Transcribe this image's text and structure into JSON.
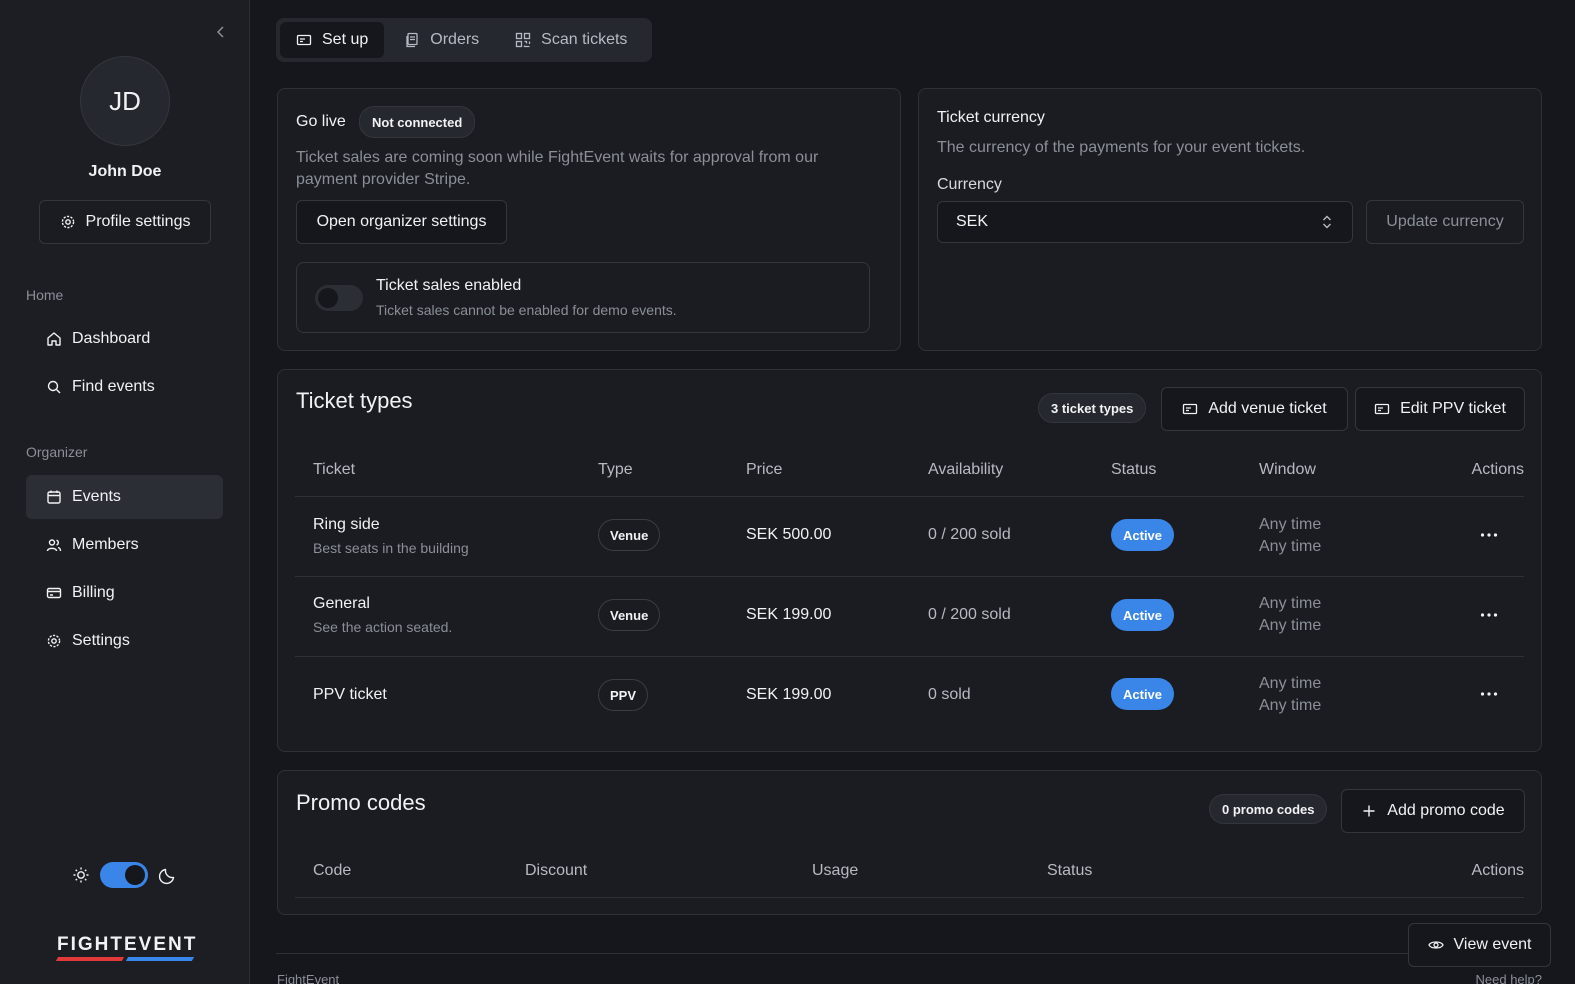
{
  "user": {
    "initials": "JD",
    "name": "John Doe",
    "profile_settings": "Profile settings"
  },
  "sidebar": {
    "home_label": "Home",
    "organizer_label": "Organizer",
    "items": [
      {
        "label": "Dashboard",
        "icon": "home-icon"
      },
      {
        "label": "Find events",
        "icon": "search-icon"
      },
      {
        "label": "Events",
        "icon": "calendar-icon",
        "active": true
      },
      {
        "label": "Members",
        "icon": "users-icon"
      },
      {
        "label": "Billing",
        "icon": "credit-card-icon"
      },
      {
        "label": "Settings",
        "icon": "gear-icon"
      }
    ],
    "theme": "dark"
  },
  "logo": {
    "text": "FIGHTEVENT",
    "colors": [
      "#e23a3a",
      "#3a86e8"
    ]
  },
  "tabs": [
    {
      "label": "Set up",
      "icon": "ticket-icon",
      "active": true
    },
    {
      "label": "Orders",
      "icon": "receipt-icon"
    },
    {
      "label": "Scan tickets",
      "icon": "qr-icon"
    }
  ],
  "go_live": {
    "title": "Go live",
    "status": "Not connected",
    "description": "Ticket sales are coming soon while FightEvent waits for approval from our payment provider Stripe.",
    "open_settings": "Open organizer settings",
    "toggle_label": "Ticket sales enabled",
    "toggle_desc": "Ticket sales cannot be enabled for demo events.",
    "enabled": false
  },
  "currency": {
    "title": "Ticket currency",
    "description": "The currency of the payments for your event tickets.",
    "field_label": "Currency",
    "value": "SEK",
    "update": "Update currency"
  },
  "ticket_types": {
    "title": "Ticket types",
    "count": "3 ticket types",
    "add_venue": "Add venue ticket",
    "edit_ppv": "Edit PPV ticket",
    "columns": [
      "Ticket",
      "Type",
      "Price",
      "Availability",
      "Status",
      "Window",
      "Actions"
    ],
    "rows": [
      {
        "name": "Ring side",
        "desc": "Best seats in the building",
        "type": "Venue",
        "price": "SEK 500.00",
        "availability": "0 / 200 sold",
        "status": "Active",
        "window_start": "Any time",
        "window_end": "Any time"
      },
      {
        "name": "General",
        "desc": "See the action seated.",
        "type": "Venue",
        "price": "SEK 199.00",
        "availability": "0 / 200 sold",
        "status": "Active",
        "window_start": "Any time",
        "window_end": "Any time"
      },
      {
        "name": "PPV ticket",
        "desc": "",
        "type": "PPV",
        "price": "SEK 199.00",
        "availability": "0 sold",
        "status": "Active",
        "window_start": "Any time",
        "window_end": "Any time"
      }
    ]
  },
  "promo": {
    "title": "Promo codes",
    "count": "0 promo codes",
    "add": "Add promo code",
    "columns": [
      "Code",
      "Discount",
      "Usage",
      "Status",
      "Actions"
    ]
  },
  "footer": {
    "brand": "FightEvent",
    "help": "Need help?"
  },
  "view_event": "View event"
}
